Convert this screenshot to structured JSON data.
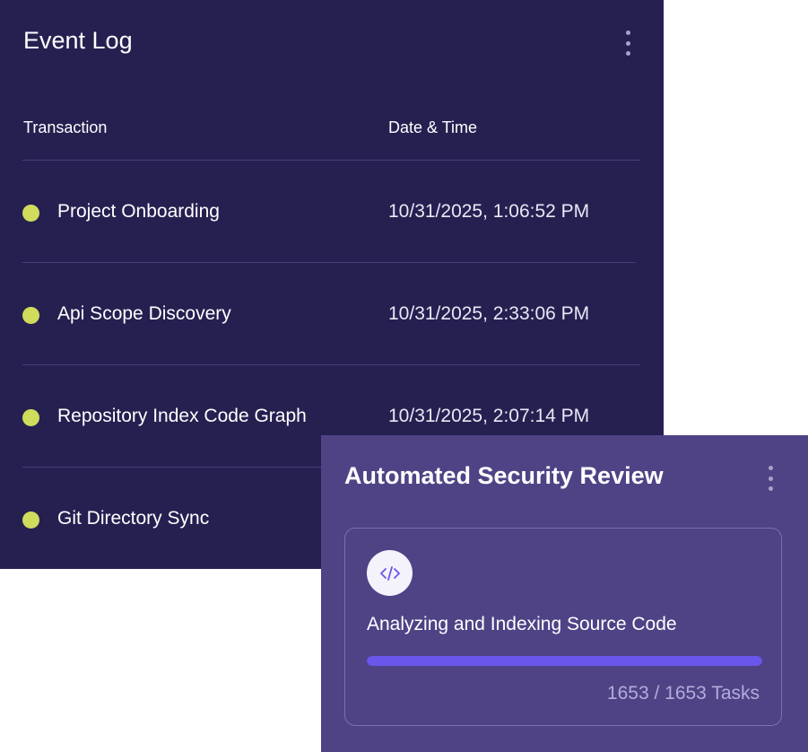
{
  "event_log": {
    "title": "Event Log",
    "menu_icon": "more-vertical-icon",
    "columns": {
      "transaction": "Transaction",
      "datetime": "Date & Time"
    },
    "rows": [
      {
        "name": "Project Onboarding",
        "datetime": "10/31/2025, 1:06:52 PM",
        "status_color": "#cfdc5c"
      },
      {
        "name": "Api Scope Discovery",
        "datetime": "10/31/2025, 2:33:06 PM",
        "status_color": "#cfdc5c"
      },
      {
        "name": "Repository Index Code Graph",
        "datetime": "10/31/2025, 2:07:14 PM",
        "status_color": "#cfdc5c"
      },
      {
        "name": "Git Directory Sync",
        "datetime": "",
        "status_color": "#cfdc5c"
      }
    ]
  },
  "review": {
    "title": "Automated Security Review",
    "menu_icon": "more-vertical-icon",
    "task": {
      "icon": "code-icon",
      "label": "Analyzing and Indexing Source Code",
      "progress_fraction": 1.0,
      "completed": "1653",
      "total": "1653",
      "count_text": "1653 / 1653 Tasks"
    }
  },
  "colors": {
    "event_log_bg": "#262051",
    "review_bg": "#4f4386",
    "status_dot": "#cfdc5c",
    "progress_fill": "#6a56ea"
  }
}
